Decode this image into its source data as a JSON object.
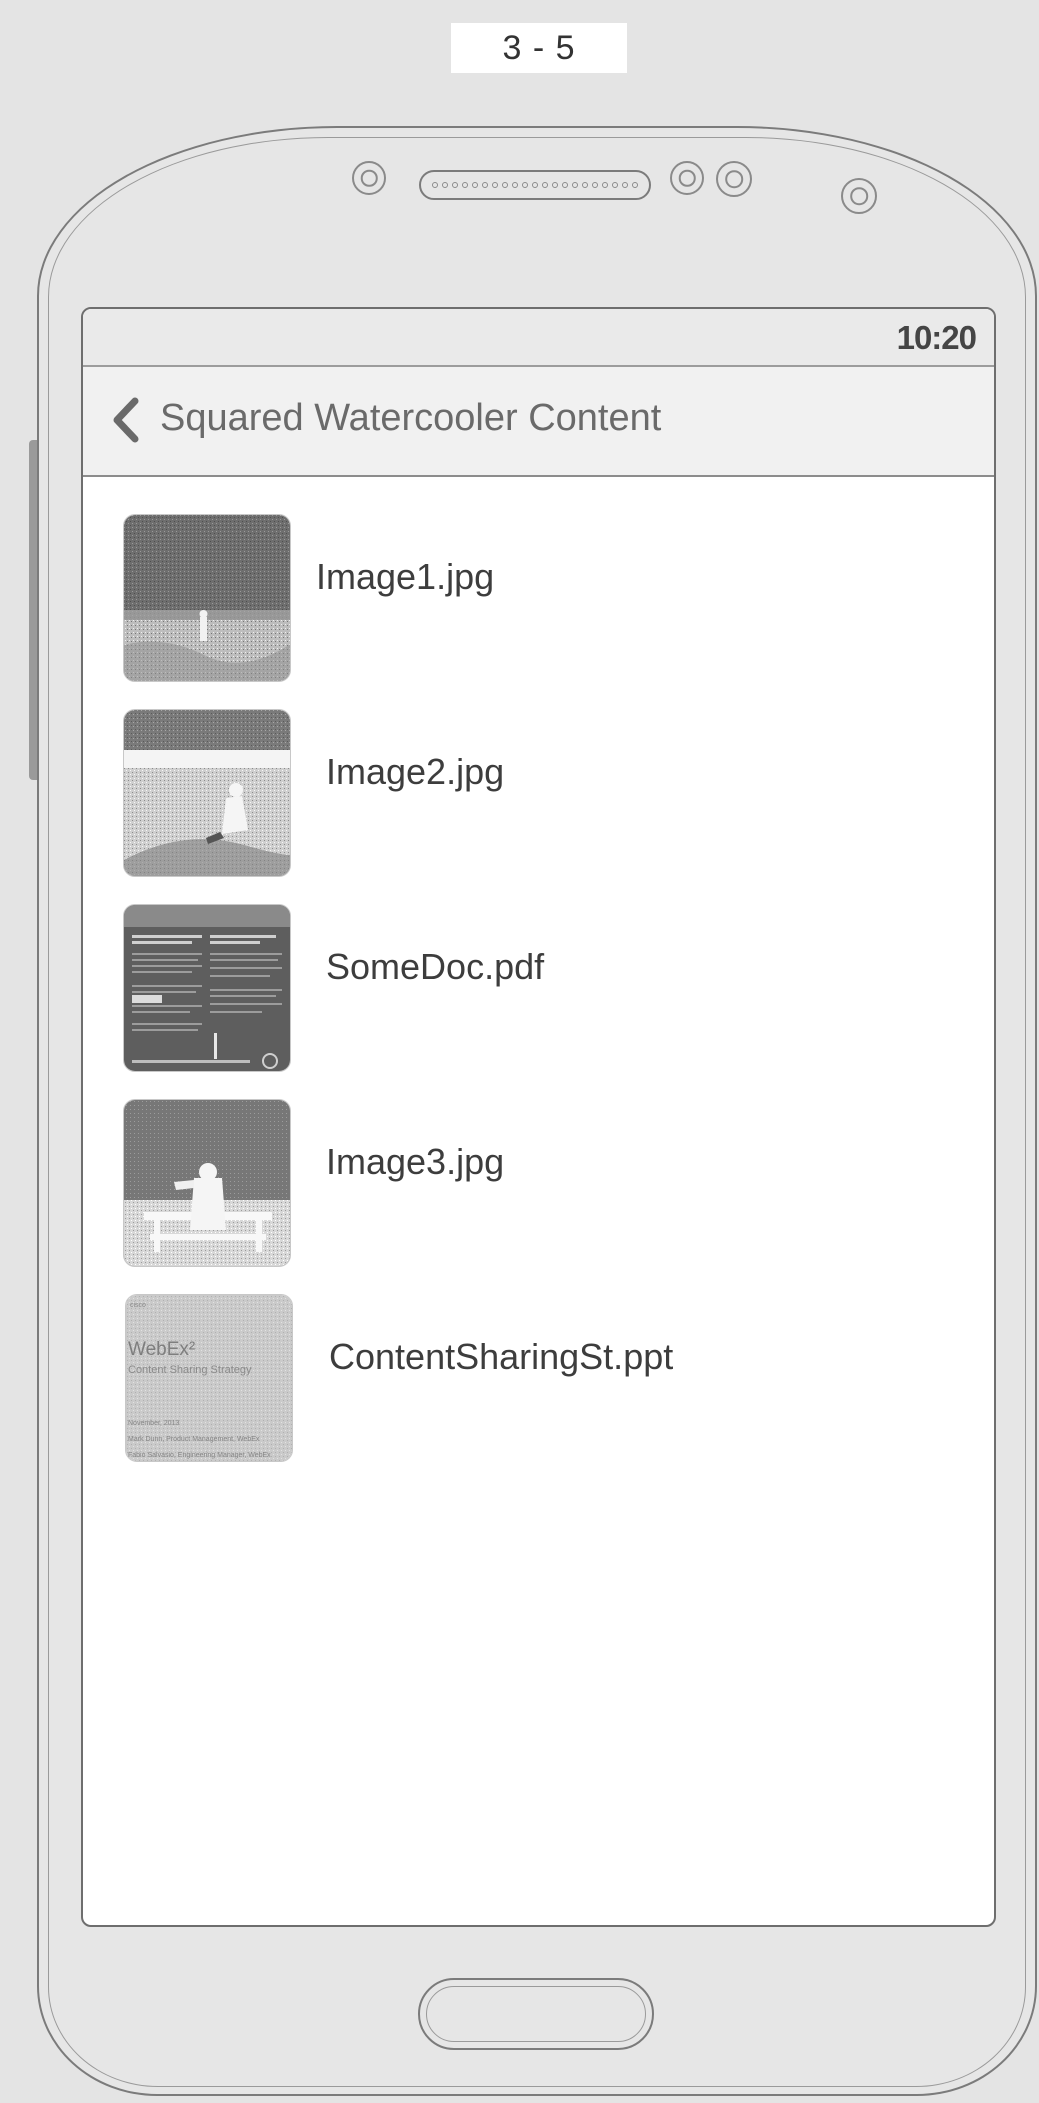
{
  "page_label": "3 - 5",
  "status_bar": {
    "time": "10:20"
  },
  "nav": {
    "title": "Squared Watercooler Content",
    "back_icon": "chevron-left-icon"
  },
  "files": [
    {
      "name": "Image1.jpg",
      "thumbnail": "landscape-photo-thumbnail"
    },
    {
      "name": "Image2.jpg",
      "thumbnail": "seated-person-photo-thumbnail"
    },
    {
      "name": "SomeDoc.pdf",
      "thumbnail": "pdf-document-thumbnail"
    },
    {
      "name": "Image3.jpg",
      "thumbnail": "bench-photo-thumbnail"
    },
    {
      "name": "ContentSharingSt.ppt",
      "thumbnail": "presentation-slide-thumbnail"
    }
  ],
  "ppt_thumbnail": {
    "brand": "cisco",
    "title": "WebEx²",
    "subtitle": "Content Sharing Strategy",
    "date": "November, 2013",
    "line1": "Mark Dunn, Product Management, WebEx",
    "line2": "Fabio Salvasio, Engineering Manager, WebEx"
  },
  "pdf_thumbnail": {
    "heading_left": "Your Deadline: 91 Days From Your Date of Hire",
    "heading_right": "What is Eligible for Cisco Benefits?"
  },
  "colors": {
    "background": "#e4e4e4",
    "screen": "#ffffff",
    "nav_bar": "#f1f1f1",
    "text": "#3d3d3d"
  }
}
